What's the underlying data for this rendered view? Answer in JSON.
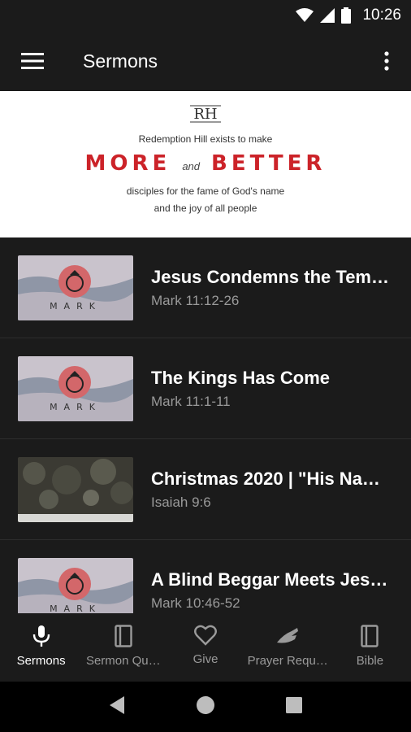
{
  "status_bar": {
    "time": "10:26"
  },
  "app_bar": {
    "title": "Sermons"
  },
  "banner": {
    "logo_text": "RH",
    "line1": "Redemption Hill exists to make",
    "word1": "MORE",
    "and": "and",
    "word2": "BETTER",
    "line3": "disciples for the fame of God's name",
    "line4": "and the joy of all people"
  },
  "sermons": [
    {
      "title": "Jesus Condemns the Tem…",
      "subtitle": "Mark 11:12-26",
      "thumb_label": "MARK"
    },
    {
      "title": "The Kings Has Come",
      "subtitle": "Mark 11:1-11",
      "thumb_label": "MARK"
    },
    {
      "title": "Christmas 2020 | \"His Na…",
      "subtitle": "Isaiah 9:6",
      "thumb_label": ""
    },
    {
      "title": "A Blind Beggar Meets Jes…",
      "subtitle": "Mark 10:46-52",
      "thumb_label": "MARK"
    }
  ],
  "bottom_nav": [
    {
      "label": "Sermons",
      "icon": "microphone-icon",
      "active": true
    },
    {
      "label": "Sermon Qu…",
      "icon": "book-icon",
      "active": false
    },
    {
      "label": "Give",
      "icon": "heart-icon",
      "active": false
    },
    {
      "label": "Prayer Requ…",
      "icon": "praying-hands-icon",
      "active": false
    },
    {
      "label": "Bible",
      "icon": "book-icon",
      "active": false
    }
  ],
  "colors": {
    "accent_red": "#cc2329",
    "background": "#1b1b1b",
    "subtext": "#9a9a9a"
  }
}
